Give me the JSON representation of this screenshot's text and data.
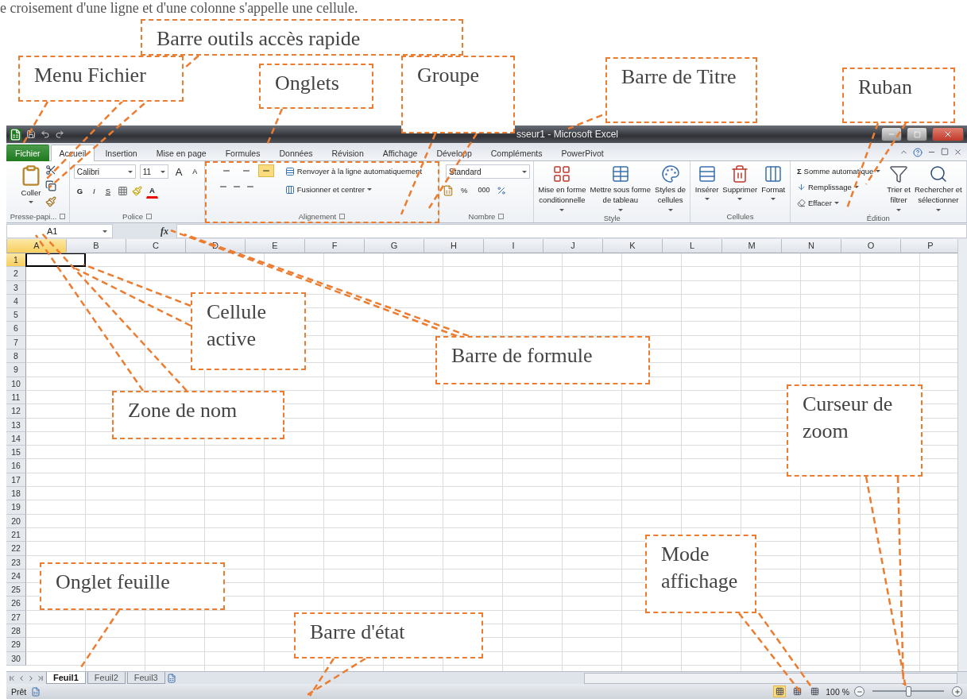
{
  "caption": "e croisement d'une ligne et d'une colonne s'appelle une cellule.",
  "window": {
    "title": "sseur1 - Microsoft Excel"
  },
  "tabs": [
    {
      "label": "Fichier",
      "kind": "file",
      "selected": false
    },
    {
      "label": "Accueil",
      "kind": "tab",
      "selected": true
    },
    {
      "label": "Insertion",
      "kind": "tab",
      "selected": false
    },
    {
      "label": "Mise en page",
      "kind": "tab",
      "selected": false
    },
    {
      "label": "Formules",
      "kind": "tab",
      "selected": false
    },
    {
      "label": "Données",
      "kind": "tab",
      "selected": false
    },
    {
      "label": "Révision",
      "kind": "tab",
      "selected": false
    },
    {
      "label": "Affichage",
      "kind": "tab",
      "selected": false
    },
    {
      "label": "Développ",
      "kind": "tab",
      "selected": false
    },
    {
      "label": "Compléments",
      "kind": "tab",
      "selected": false
    },
    {
      "label": "PowerPivot",
      "kind": "tab",
      "selected": false
    }
  ],
  "ribbon": {
    "groups": [
      {
        "kind": "clipboard",
        "label": "Presse-papi...",
        "launcher": true,
        "paste": "Coller"
      },
      {
        "kind": "font",
        "label": "Police",
        "launcher": true,
        "font": "Calibri",
        "size": "11",
        "grow": "A",
        "shrink": "A",
        "bold": "G",
        "italic": "I",
        "underline": "S",
        "font_color_letter": "A"
      },
      {
        "kind": "alignment",
        "label": "Alignement",
        "launcher": true,
        "wrap": "Renvoyer à la ligne automatiquement",
        "merge": "Fusionner et centrer",
        "valign": [
          {
            "selected": false
          },
          {
            "selected": false
          },
          {
            "selected": true
          }
        ]
      },
      {
        "kind": "number",
        "label": "Nombre",
        "launcher": true,
        "format": "Standard",
        "percent": "%",
        "thousands": "000"
      },
      {
        "kind": "big",
        "label": "Style",
        "launcher": false,
        "items": [
          {
            "lines": [
              "Mise en forme",
              "conditionnelle"
            ]
          },
          {
            "lines": [
              "Mettre sous forme",
              "de tableau"
            ]
          },
          {
            "lines": [
              "Styles de",
              "cellules"
            ]
          }
        ]
      },
      {
        "kind": "big",
        "label": "Cellules",
        "launcher": false,
        "items": [
          {
            "lines": [
              "Insérer"
            ]
          },
          {
            "lines": [
              "Supprimer"
            ]
          },
          {
            "lines": [
              "Format"
            ]
          }
        ]
      },
      {
        "kind": "editing",
        "label": "Édition",
        "launcher": false,
        "sum_sign": "Σ",
        "small": [
          "Somme automatique",
          "Remplissage",
          "Effacer"
        ],
        "items": [
          {
            "lines": [
              "Trier et",
              "filtrer"
            ]
          },
          {
            "lines": [
              "Rechercher et",
              "sélectionner"
            ]
          }
        ]
      }
    ]
  },
  "formula_bar": {
    "name_box": "A1",
    "fx": "fx"
  },
  "sheet": {
    "columns": [
      {
        "label": "A",
        "selected": true
      },
      {
        "label": "B",
        "selected": false
      },
      {
        "label": "C",
        "selected": false
      },
      {
        "label": "D",
        "selected": false
      },
      {
        "label": "E",
        "selected": false
      },
      {
        "label": "F",
        "selected": false
      },
      {
        "label": "G",
        "selected": false
      },
      {
        "label": "H",
        "selected": false
      },
      {
        "label": "I",
        "selected": false
      },
      {
        "label": "J",
        "selected": false
      },
      {
        "label": "K",
        "selected": false
      },
      {
        "label": "L",
        "selected": false
      },
      {
        "label": "M",
        "selected": false
      },
      {
        "label": "N",
        "selected": false
      },
      {
        "label": "O",
        "selected": false
      },
      {
        "label": "P",
        "selected": false
      }
    ],
    "rows": [
      {
        "label": "1",
        "selected": true
      },
      {
        "label": "2",
        "selected": false
      },
      {
        "label": "3",
        "selected": false
      },
      {
        "label": "4",
        "selected": false
      },
      {
        "label": "5",
        "selected": false
      },
      {
        "label": "6",
        "selected": false
      },
      {
        "label": "7",
        "selected": false
      },
      {
        "label": "8",
        "selected": false
      },
      {
        "label": "9",
        "selected": false
      },
      {
        "label": "10",
        "selected": false
      },
      {
        "label": "11",
        "selected": false
      },
      {
        "label": "12",
        "selected": false
      },
      {
        "label": "13",
        "selected": false
      },
      {
        "label": "14",
        "selected": false
      },
      {
        "label": "15",
        "selected": false
      },
      {
        "label": "16",
        "selected": false
      },
      {
        "label": "17",
        "selected": false
      },
      {
        "label": "18",
        "selected": false
      },
      {
        "label": "19",
        "selected": false
      },
      {
        "label": "20",
        "selected": false
      },
      {
        "label": "21",
        "selected": false
      },
      {
        "label": "22",
        "selected": false
      },
      {
        "label": "23",
        "selected": false
      },
      {
        "label": "24",
        "selected": false
      },
      {
        "label": "25",
        "selected": false
      },
      {
        "label": "26",
        "selected": false
      },
      {
        "label": "27",
        "selected": false
      },
      {
        "label": "28",
        "selected": false
      },
      {
        "label": "29",
        "selected": false
      },
      {
        "label": "30",
        "selected": false
      }
    ]
  },
  "sheet_tabs": [
    {
      "label": "Feuil1",
      "selected": true
    },
    {
      "label": "Feuil2",
      "selected": false
    },
    {
      "label": "Feuil3",
      "selected": false
    }
  ],
  "status_bar": {
    "text": "Prêt",
    "view_modes": [
      {
        "selected": true
      },
      {
        "selected": false
      },
      {
        "selected": false
      }
    ],
    "zoom": "100 %",
    "zoom_slider": {
      "level": 0.5
    }
  },
  "annotations": [
    {
      "label": "Barre outils accès rapide"
    },
    {
      "label": "Menu Fichier"
    },
    {
      "label": "Onglets"
    },
    {
      "label": "Groupe"
    },
    {
      "label": "Barre de Titre"
    },
    {
      "label": "Ruban"
    },
    {
      "label": "Cellule active"
    },
    {
      "label": "Barre de formule"
    },
    {
      "label": "Zone de nom"
    },
    {
      "label": "Curseur de zoom"
    },
    {
      "label": "Onglet feuille"
    },
    {
      "label": "Mode affichage"
    },
    {
      "label": "Barre d'état"
    }
  ]
}
